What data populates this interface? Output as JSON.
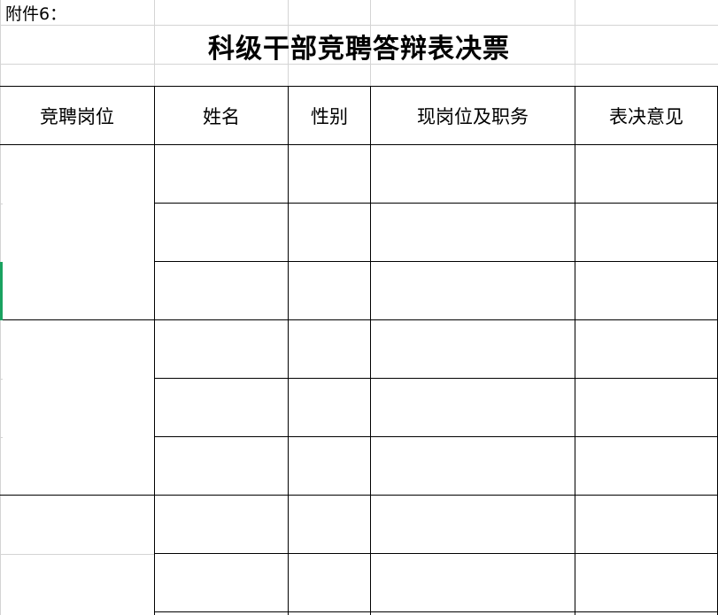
{
  "attachment_label": "附件6：",
  "title": "科级干部竞聘答辩表决票",
  "headers": [
    "竞聘岗位",
    "姓名",
    "性别",
    "现岗位及职务",
    "表决意见"
  ],
  "rows": [
    [
      "",
      "",
      "",
      "",
      ""
    ],
    [
      "",
      "",
      "",
      "",
      ""
    ],
    [
      "",
      "",
      "",
      "",
      ""
    ],
    [
      "",
      "",
      "",
      "",
      ""
    ],
    [
      "",
      "",
      "",
      "",
      ""
    ],
    [
      "",
      "",
      "",
      "",
      ""
    ],
    [
      "",
      "",
      "",
      "",
      ""
    ],
    [
      "",
      "",
      "",
      "",
      ""
    ]
  ],
  "colors": {
    "gridline": "#d4d4d4",
    "border": "#000000",
    "selection": "#1aa260"
  }
}
